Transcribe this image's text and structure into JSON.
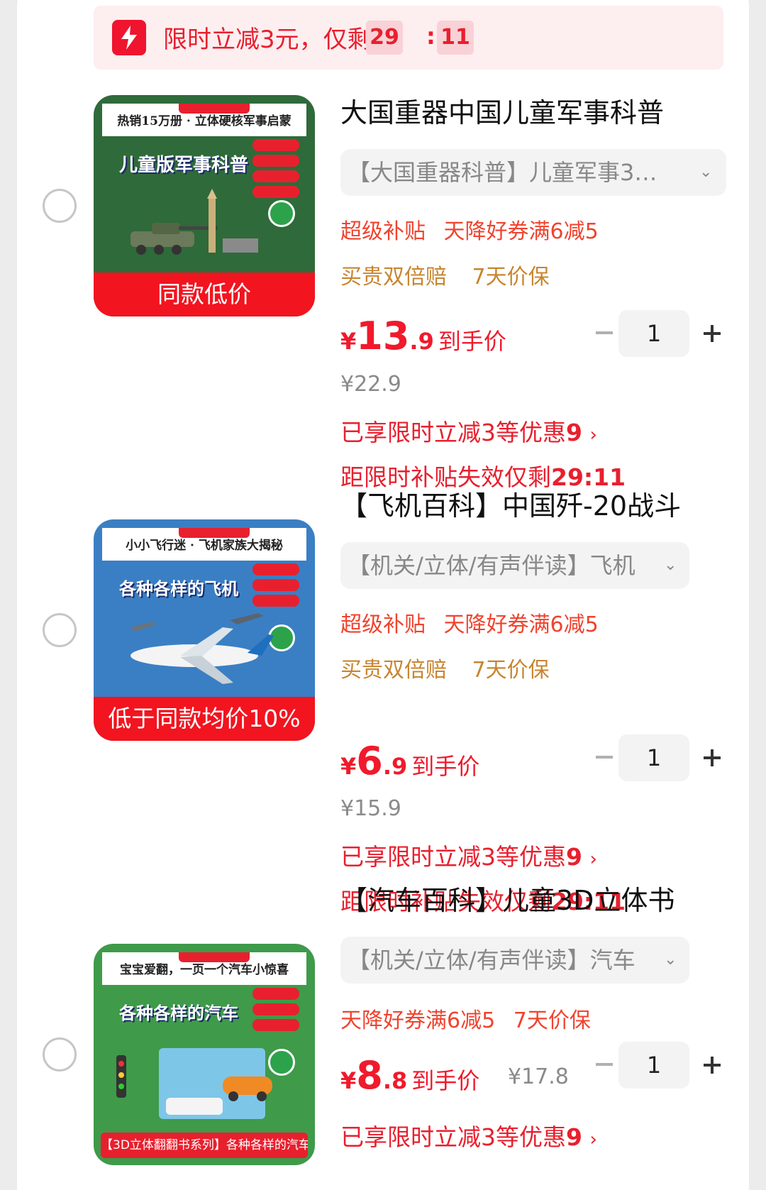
{
  "banner": {
    "text": "限时立减3元，仅剩",
    "minutes": "29",
    "seconds": "11"
  },
  "items": [
    {
      "title": "大国重器中国儿童军事科普",
      "sku": "【大国重器科普】儿童军事3…",
      "tags_red": [
        "超级补贴",
        "天降好券满6减5"
      ],
      "tags_orange": [
        "买贵双倍赔",
        "7天价保"
      ],
      "price_currency": "¥",
      "price_int": "13",
      "price_dec": ".9",
      "price_label": "到手价",
      "original_price": "¥22.9",
      "promo_prefix": "已享限时立减3等优惠",
      "promo_amount": "9",
      "countdown_prefix": "距限时补贴失效仅剩",
      "countdown": "29:11",
      "quantity": "1",
      "thumb_badge": "同款低价",
      "book_top": "热销15万册 · 立体硬核军事启蒙",
      "book_title": "儿童版军事科普",
      "book_color": "#2f6a3a"
    },
    {
      "title": "【飞机百科】中国歼-20战斗",
      "sku": "【机关/立体/有声伴读】飞机",
      "tags_red": [
        "超级补贴",
        "天降好券满6减5"
      ],
      "tags_orange": [
        "买贵双倍赔",
        "7天价保"
      ],
      "price_currency": "¥",
      "price_int": "6",
      "price_dec": ".9",
      "price_label": "到手价",
      "original_price": "¥15.9",
      "promo_prefix": "已享限时立减3等优惠",
      "promo_amount": "9",
      "countdown_prefix": "距限时补贴失效仅剩",
      "countdown": "29:11",
      "quantity": "1",
      "thumb_badge": "低于同款均价10%",
      "book_top": "小小飞行迷 · 飞机家族大揭秘",
      "book_title": "各种各样的飞机",
      "book_color": "#3a7fc4"
    },
    {
      "title": "【汽车百科】儿童3D立体书",
      "sku": "【机关/立体/有声伴读】汽车",
      "tags_red": [
        "天降好券满6减5"
      ],
      "tags_orange": [
        "7天价保"
      ],
      "price_currency": "¥",
      "price_int": "8",
      "price_dec": ".8",
      "price_label": "到手价",
      "original_price": "¥17.8",
      "promo_prefix": "已享限时立减3等优惠",
      "promo_amount": "9",
      "quantity": "1",
      "thumb_caption": "【3D立体翻翻书系列】各种各样的汽车",
      "book_top": "宝宝爱翻，一页一个汽车小惊喜",
      "book_title": "各种各样的汽车",
      "book_color": "#3f9a4a"
    }
  ]
}
